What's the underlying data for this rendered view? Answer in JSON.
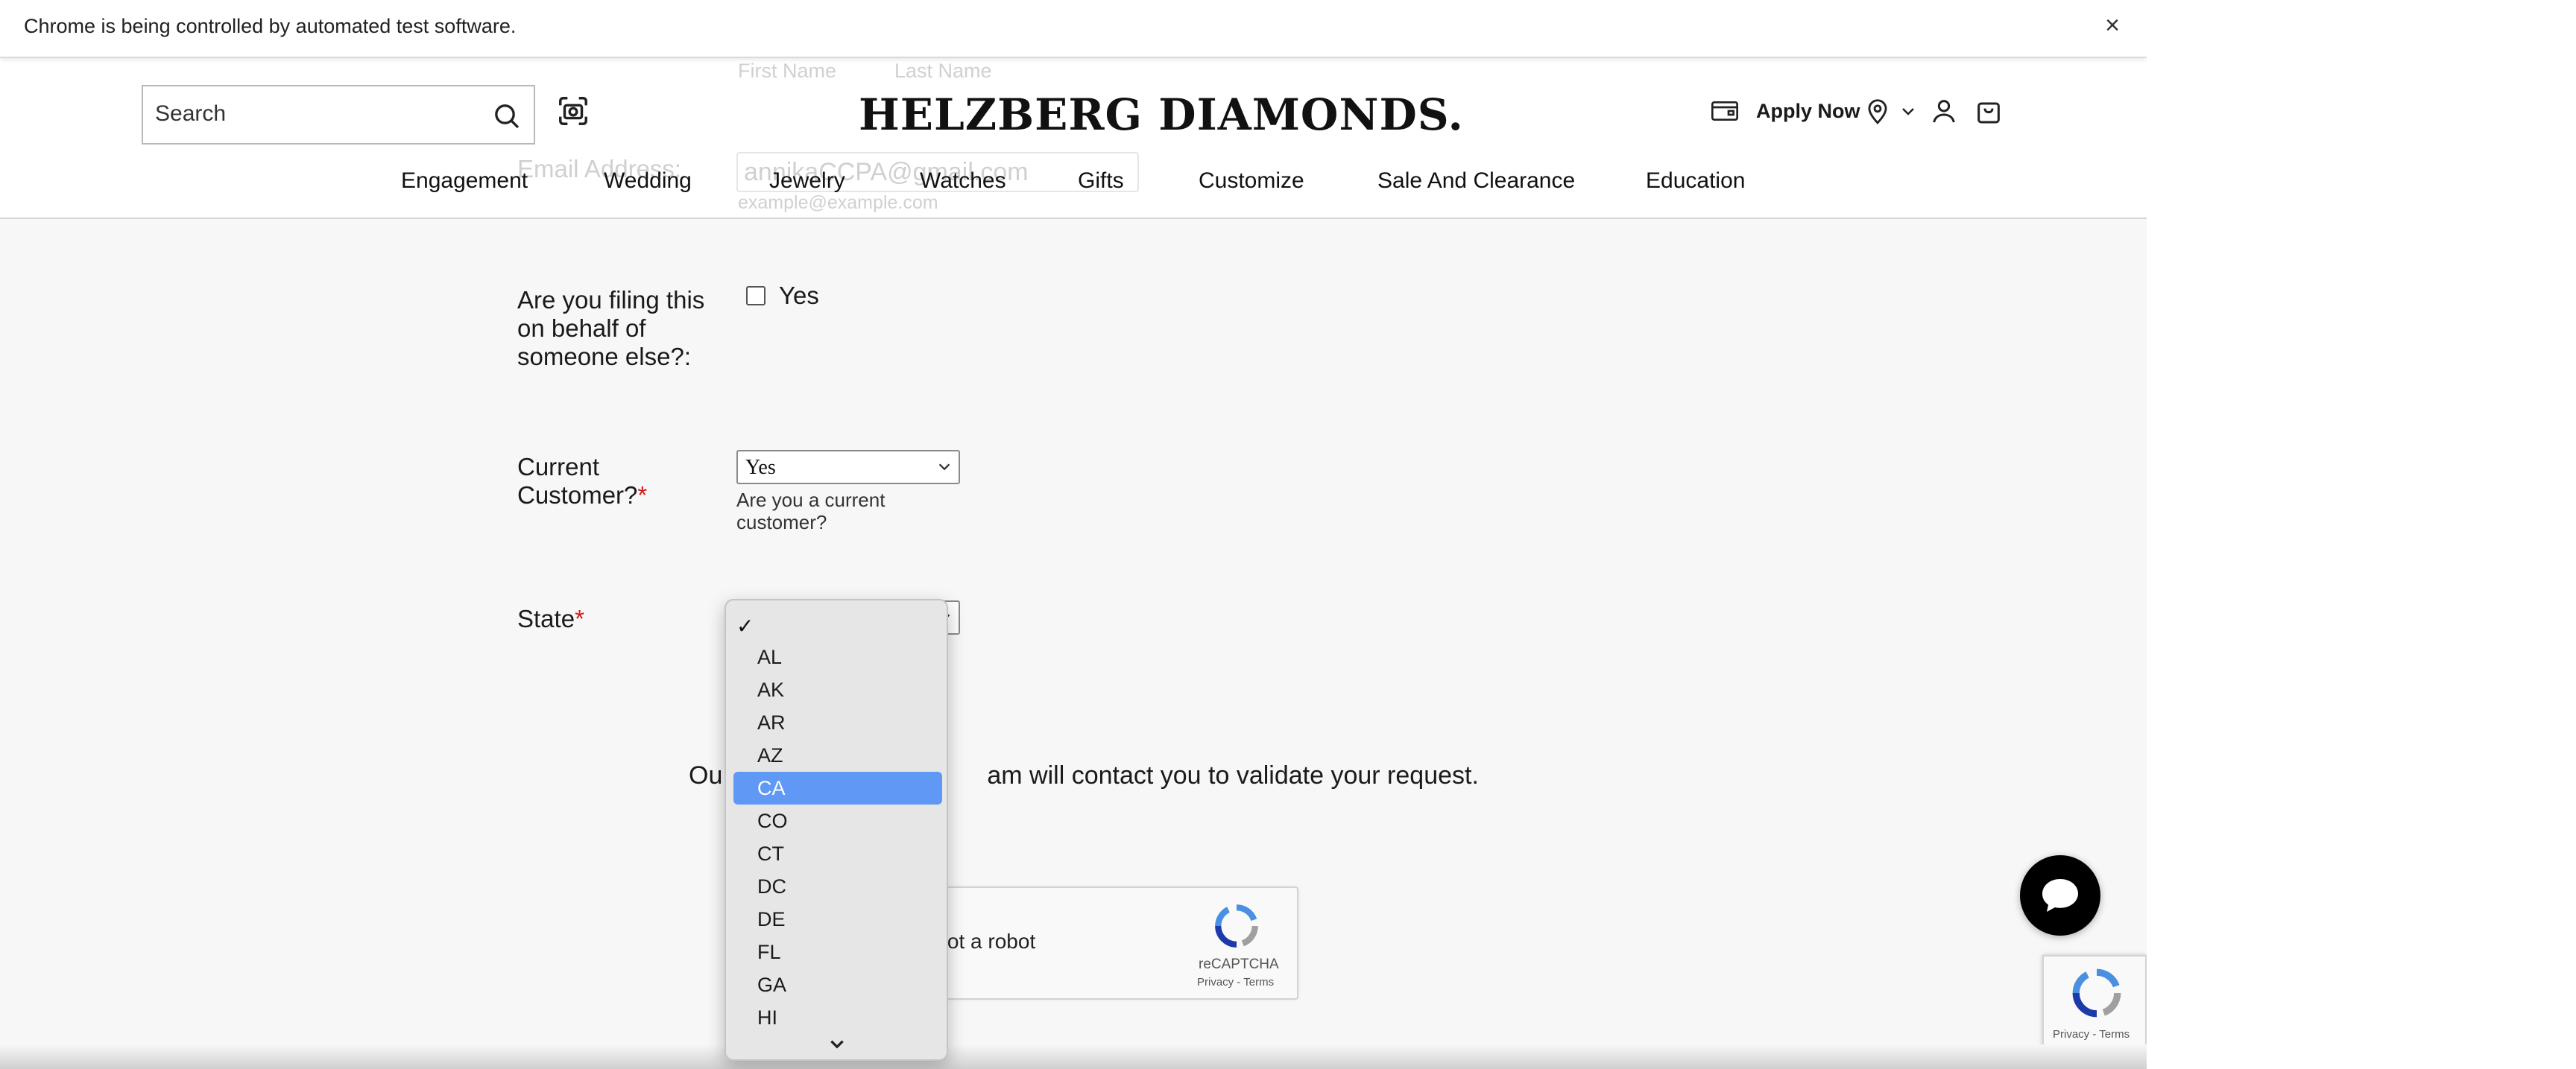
{
  "automation_bar": {
    "message": "Chrome is being controlled by automated test software.",
    "close": "×"
  },
  "header": {
    "search_placeholder": "Search",
    "logo": "HELZBERG DIAMONDS.",
    "apply_now": "Apply Now",
    "nav": [
      "Engagement",
      "Wedding",
      "Jewelry",
      "Watches",
      "Gifts",
      "Customize",
      "Sale And Clearance",
      "Education"
    ]
  },
  "ghost_form": {
    "first_name": "First Name",
    "last_name": "Last Name",
    "email_label": "Email Address:",
    "email_value": "annikaCCPA@gmail.com",
    "email_hint": "example@example.com"
  },
  "form": {
    "behalf_label": "Are you filing this on behalf of someone else?:",
    "behalf_option": "Yes",
    "current_customer_label": "Current Customer?",
    "required_mark": "*",
    "current_customer_value": "Yes",
    "current_customer_hint": "Are you a current customer?",
    "state_label": "State",
    "contact_prefix": "Ou",
    "contact_suffix": "am will contact you to validate your request."
  },
  "captcha": {
    "text": "n not a robot",
    "brand": "reCAPTCHA",
    "links": "Privacy - Terms"
  },
  "recaptcha_badge": {
    "links": "Privacy - Terms"
  },
  "state_dropdown": {
    "check": "✓",
    "options": [
      "AL",
      "AK",
      "AR",
      "AZ",
      "CA",
      "CO",
      "CT",
      "DC",
      "DE",
      "FL",
      "GA",
      "HI"
    ],
    "selected": "CA"
  },
  "colors": {
    "selected_option": "#5f98f5",
    "required": "#d11919",
    "chat_button": "#000000"
  }
}
